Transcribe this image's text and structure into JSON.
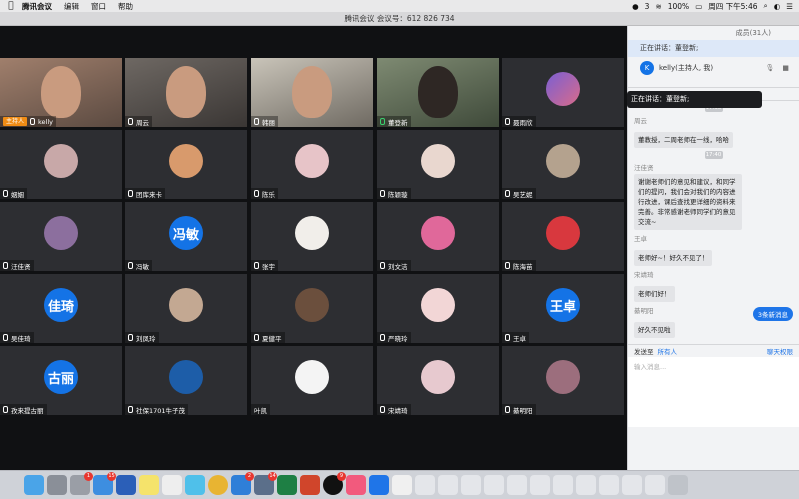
{
  "menubar": {
    "app_name": "腾讯会议",
    "items": [
      "编辑",
      "窗口",
      "帮助"
    ],
    "battery": "100%",
    "datetime": "周四 下午5:46",
    "notification_count": "3"
  },
  "window": {
    "title": "腾讯会议 会议号：612 826 734"
  },
  "participants": [
    {
      "name": "kelly",
      "host_label": "主持人",
      "type": "camera"
    },
    {
      "name": "周云",
      "type": "camera"
    },
    {
      "name": "韩丽",
      "type": "camera"
    },
    {
      "name": "董登新",
      "type": "camera",
      "speaking": true
    },
    {
      "name": "聂雨欣",
      "type": "avatar"
    },
    {
      "name": "姻姻",
      "type": "avatar"
    },
    {
      "name": "团库来卡",
      "type": "avatar"
    },
    {
      "name": "陈乐",
      "type": "avatar"
    },
    {
      "name": "陈颖璇",
      "type": "avatar"
    },
    {
      "name": "吴艺妮",
      "type": "avatar"
    },
    {
      "name": "汪佳贤",
      "type": "avatar"
    },
    {
      "name": "冯敏",
      "type": "text_avatar",
      "avatar_text": "冯敏"
    },
    {
      "name": "张宇",
      "type": "avatar"
    },
    {
      "name": "刘文洁",
      "type": "avatar"
    },
    {
      "name": "陈海苗",
      "type": "avatar"
    },
    {
      "name": "吴佳琦",
      "type": "text_avatar",
      "avatar_text": "佳琦"
    },
    {
      "name": "刘凤玲",
      "type": "avatar"
    },
    {
      "name": "夏健平",
      "type": "avatar"
    },
    {
      "name": "严晓玲",
      "type": "avatar"
    },
    {
      "name": "王卓",
      "type": "text_avatar",
      "avatar_text": "王卓"
    },
    {
      "name": "孜来提古丽",
      "type": "text_avatar",
      "avatar_text": "古丽"
    },
    {
      "name": "社保1701牛子茂",
      "type": "avatar"
    },
    {
      "name": "叶凯",
      "type": "avatar"
    },
    {
      "name": "宋靖琦",
      "type": "avatar"
    },
    {
      "name": "綦明阳",
      "type": "avatar"
    }
  ],
  "speaking_popup": {
    "text": "正在讲话：董登新;"
  },
  "panel": {
    "members_header": "成员(31人)",
    "speaking_now": "正在讲话：董登新;",
    "self_member": {
      "avatar_letter": "K",
      "label": "kelly(主持人, 我)"
    },
    "chat_header": "聊天",
    "messages": [
      {
        "time": "17:38",
        "sender": "周云",
        "text": "董教授，二周老师在一线，哈哈"
      },
      {
        "time": "17:40",
        "sender": "汪佳贤",
        "text": "谢谢老师们的意见和建议，和同学们的提问，我们会对我们的内容进行改进，课后查找更详细的资料来完善。非常感谢老师同学们的意见交流~"
      },
      {
        "sender": "王卓",
        "text": "老师好~！好久不见了！"
      },
      {
        "sender": "宋靖琦",
        "text": "老师们好！"
      },
      {
        "sender": "綦明阳",
        "text": "好久不见啦"
      }
    ],
    "new_messages_label": "3条新消息",
    "send_to_label": "发送至",
    "send_to_value": "所有人",
    "permission_label": "聊天权限",
    "input_placeholder": "输入消息..."
  },
  "dock": {
    "badges": {
      "system_prefs": "1",
      "mail": "15",
      "chrome_store": "2",
      "calendar": "14",
      "qq": "9"
    }
  }
}
